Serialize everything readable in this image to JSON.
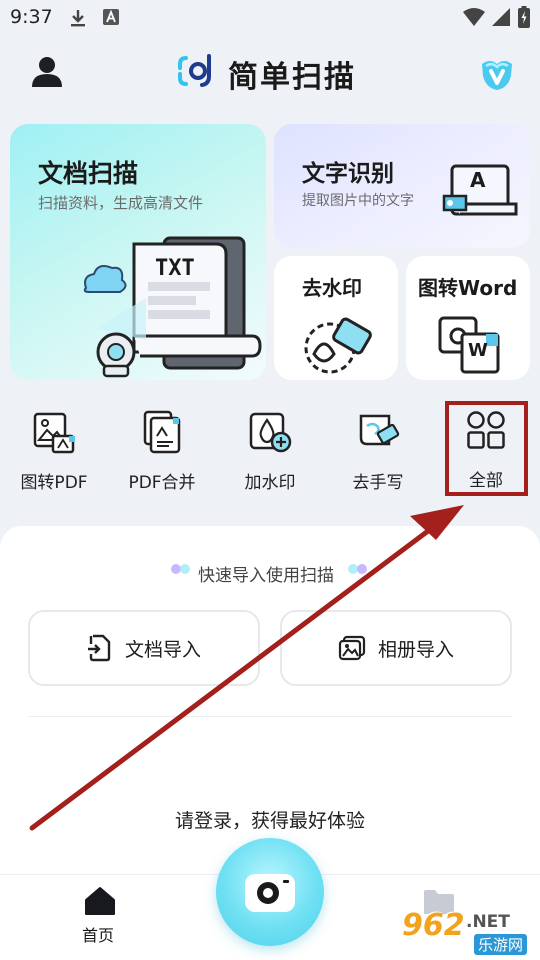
{
  "status_bar": {
    "time": "9:37"
  },
  "header": {
    "title": "简单扫描"
  },
  "cards": {
    "doc_scan": {
      "title": "文档扫描",
      "subtitle": "扫描资料，生成高清文件",
      "illustration_text": "TXT"
    },
    "ocr": {
      "title": "文字识别",
      "subtitle": "提取图片中的文字",
      "illustration_text": "A"
    },
    "watermark": {
      "title": "去水印"
    },
    "img2word": {
      "title": "图转Word",
      "illustration_text": "W"
    }
  },
  "tools": [
    {
      "label": "图转PDF",
      "icon": "image-to-pdf-icon"
    },
    {
      "label": "PDF合并",
      "icon": "pdf-merge-icon"
    },
    {
      "label": "加水印",
      "icon": "add-watermark-icon"
    },
    {
      "label": "去手写",
      "icon": "remove-handwriting-icon"
    },
    {
      "label": "全部",
      "icon": "all-grid-icon"
    }
  ],
  "import": {
    "section_title": "快速导入使用扫描",
    "doc_import": "文档导入",
    "album_import": "相册导入"
  },
  "login_prompt": "请登录，获得最好体验",
  "nav": {
    "home": "首页"
  },
  "watermark_brand": {
    "number": "962",
    "suffix": ".NET",
    "name": "乐游网"
  },
  "colors": {
    "accent": "#2fb7e6",
    "highlight_box": "#a3201c",
    "arrow": "#a3201c"
  }
}
